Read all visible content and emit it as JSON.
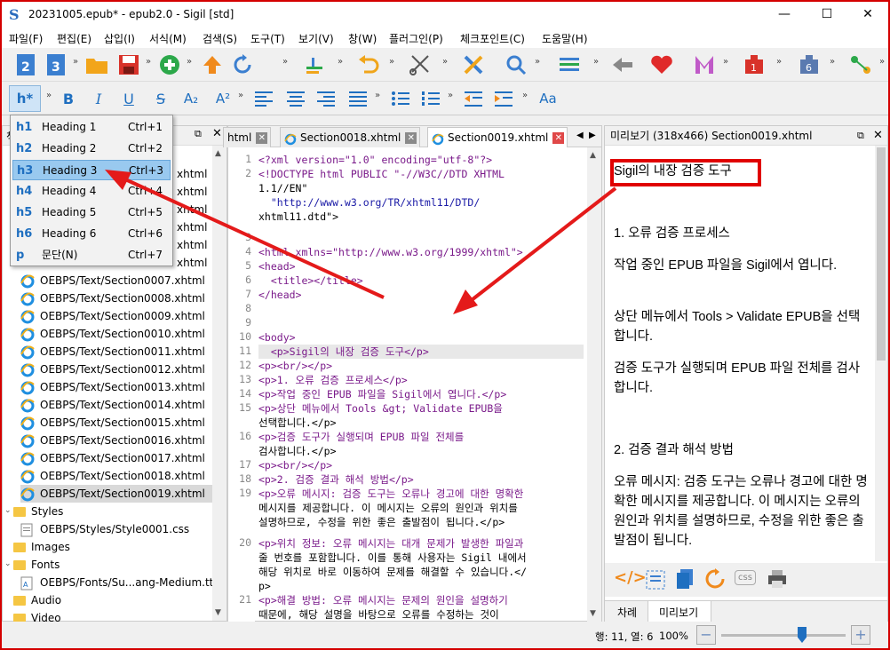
{
  "window": {
    "title": "20231005.epub* - epub2.0 - Sigil [std]",
    "minimize": "—",
    "maximize": "☐",
    "close": "✕"
  },
  "menu": [
    "파일(F)",
    "편집(E)",
    "삽입(I)",
    "서식(M)",
    "검색(S)",
    "도구(T)",
    "보기(V)",
    "창(W)",
    "플러그인(P)",
    "체크포인트(C)",
    "도움말(H)"
  ],
  "toolbar2": {
    "heading_button": "h*",
    "bold": "B",
    "italic": "I",
    "underline": "U",
    "strike": "S",
    "subscript": "A₂",
    "superscript": "A²",
    "font_button": "Aa"
  },
  "heading_menu": [
    {
      "tag": "h1",
      "label": "Heading 1",
      "shortcut": "Ctrl+1"
    },
    {
      "tag": "h2",
      "label": "Heading 2",
      "shortcut": "Ctrl+2"
    },
    {
      "tag": "h3",
      "label": "Heading 3",
      "shortcut": "Ctrl+3"
    },
    {
      "tag": "h4",
      "label": "Heading 4",
      "shortcut": "Ctrl+4"
    },
    {
      "tag": "h5",
      "label": "Heading 5",
      "shortcut": "Ctrl+5"
    },
    {
      "tag": "h6",
      "label": "Heading 6",
      "shortcut": "Ctrl+6"
    },
    {
      "tag": "p",
      "label": "문단(N)",
      "shortcut": "Ctrl+7"
    }
  ],
  "book_browser": {
    "header_stub": "책",
    "partial_rows": [
      "xhtml",
      "xhtml",
      "xhtml",
      "xhtml",
      "xhtml",
      "xhtml"
    ],
    "files": [
      "OEBPS/Text/Section0007.xhtml",
      "OEBPS/Text/Section0008.xhtml",
      "OEBPS/Text/Section0009.xhtml",
      "OEBPS/Text/Section0010.xhtml",
      "OEBPS/Text/Section0011.xhtml",
      "OEBPS/Text/Section0012.xhtml",
      "OEBPS/Text/Section0013.xhtml",
      "OEBPS/Text/Section0014.xhtml",
      "OEBPS/Text/Section0015.xhtml",
      "OEBPS/Text/Section0016.xhtml",
      "OEBPS/Text/Section0017.xhtml",
      "OEBPS/Text/Section0018.xhtml",
      "OEBPS/Text/Section0019.xhtml"
    ],
    "folders": {
      "styles": "Styles",
      "style_file": "OEBPS/Styles/Style0001.css",
      "images": "Images",
      "fonts": "Fonts",
      "font_file": "OEBPS/Fonts/Su...ang-Medium.ttf",
      "audio": "Audio",
      "video": "Video"
    }
  },
  "editor_tabs": [
    "html",
    "Section0018.xhtml",
    "Section0019.xhtml"
  ],
  "code_lines": [
    {
      "n": "1",
      "t": "<?xml version=\"1.0\" encoding=\"utf-8\"?>"
    },
    {
      "n": "2",
      "t": "<!DOCTYPE html PUBLIC \"-//W3C//DTD XHTML"
    },
    {
      "n": "",
      "t": "1.1//EN\""
    },
    {
      "n": "",
      "t": "  \"http://www.w3.org/TR/xhtml11/DTD/"
    },
    {
      "n": "",
      "t": "xhtml11.dtd\">"
    },
    {
      "n": "3",
      "t": ""
    },
    {
      "n": "4",
      "t": "<html xmlns=\"http://www.w3.org/1999/xhtml\">"
    },
    {
      "n": "5",
      "t": "<head>"
    },
    {
      "n": "6",
      "t": "  <title></title>"
    },
    {
      "n": "7",
      "t": "</head>"
    },
    {
      "n": "8",
      "t": ""
    },
    {
      "n": "9",
      "t": ""
    },
    {
      "n": "10",
      "t": "<body>"
    },
    {
      "n": "11",
      "t": "  <p>Sigil의 내장 검증 도구</p>"
    },
    {
      "n": "12",
      "t": "<p><br/></p>"
    },
    {
      "n": "13",
      "t": "<p>1. 오류 검증 프로세스</p>"
    },
    {
      "n": "14",
      "t": "<p>작업 중인 EPUB 파일을 Sigil에서 엽니다.</p>"
    },
    {
      "n": "15",
      "t": "<p>상단 메뉴에서 Tools &gt; Validate EPUB을"
    },
    {
      "n": "",
      "t": "선택합니다.</p>"
    },
    {
      "n": "16",
      "t": "<p>검증 도구가 실행되며 EPUB 파일 전체를"
    },
    {
      "n": "",
      "t": "검사합니다.</p>"
    },
    {
      "n": "17",
      "t": "<p><br/></p>"
    },
    {
      "n": "18",
      "t": "<p>2. 검증 결과 해석 방법</p>"
    },
    {
      "n": "19",
      "t": "<p>오류 메시지: 검증 도구는 오류나 경고에 대한 명확한"
    },
    {
      "n": "",
      "t": "메시지를 제공합니다. 이 메시지는 오류의 원인과 위치를"
    },
    {
      "n": "",
      "t": "설명하므로, 수정을 위한 좋은 출발점이 됩니다.</p>"
    },
    {
      "n": "20",
      "t": "<p>위치 정보: 오류 메시지는 대개 문제가 발생한 파일과"
    },
    {
      "n": "",
      "t": "줄 번호를 포함합니다. 이를 통해 사용자는 Sigil 내에서"
    },
    {
      "n": "",
      "t": "해당 위치로 바로 이동하여 문제를 해결할 수 있습니다.</"
    },
    {
      "n": "",
      "t": "p>"
    },
    {
      "n": "21",
      "t": "<p>해결 방법: 오류 메시지는 문제의 원인을 설명하기"
    },
    {
      "n": "",
      "t": "때문에, 해당 설명을 바탕으로 오류를 수정하는 것이"
    }
  ],
  "preview": {
    "header": "미리보기 (318x466) Section0019.xhtml",
    "heading": "Sigil의 내장 검증 도구",
    "paragraphs": [
      "1. 오류 검증 프로세스",
      "작업 중인 EPUB 파일을 Sigil에서 엽니다.",
      "상단 메뉴에서 Tools > Validate EPUB을 선택합니다.",
      "검증 도구가 실행되며 EPUB 파일 전체를 검사합니다.",
      "2. 검증 결과 해석 방법",
      "오류 메시지: 검증 도구는 오류나 경고에 대한 명확한 메시지를 제공합니다. 이 메시지는 오류의 원인과 위치를 설명하므로, 수정을 위한 좋은 출발점이 됩니다."
    ],
    "tab_toc": "차례",
    "tab_preview": "미리보기"
  },
  "status": {
    "position": "행: 11, 열: 6",
    "zoom": "100%",
    "zoom_fraction": 0.65
  }
}
